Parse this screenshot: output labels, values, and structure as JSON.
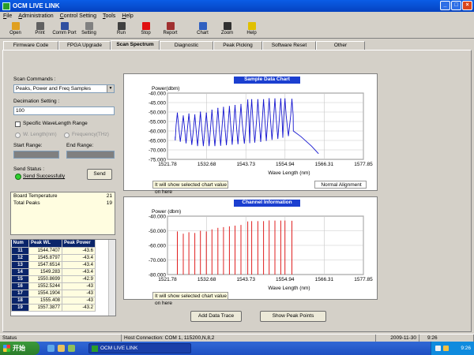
{
  "window": {
    "title": "OCM LIVE LINK"
  },
  "menu": [
    {
      "label": "File",
      "key": "F",
      "rest": "ile"
    },
    {
      "label": "Administration",
      "key": "A",
      "rest": "dministration"
    },
    {
      "label": "Control Setting",
      "key": "C",
      "rest": "ontrol Setting"
    },
    {
      "label": "Tools",
      "key": "T",
      "rest": "ools"
    },
    {
      "label": "Help",
      "key": "H",
      "rest": "elp"
    }
  ],
  "toolbar": [
    {
      "name": "open",
      "label": "Open",
      "icon": "folder-icon",
      "color": "#e0a020"
    },
    {
      "name": "print",
      "label": "Print",
      "icon": "printer-icon",
      "color": "#606060"
    },
    {
      "name": "comm-port",
      "label": "Comm Port",
      "icon": "plug-icon",
      "color": "#3050a0"
    },
    {
      "name": "setting",
      "label": "Setting",
      "icon": "gear-icon",
      "color": "#808080"
    },
    {
      "name": "run",
      "label": "Run",
      "icon": "run-icon",
      "color": "#404040"
    },
    {
      "name": "stop",
      "label": "Stop",
      "icon": "stop-icon",
      "color": "#e01010"
    },
    {
      "name": "report",
      "label": "Report",
      "icon": "report-icon",
      "color": "#a03030"
    },
    {
      "name": "chart",
      "label": "Chart",
      "icon": "chart-icon",
      "color": "#3060c0"
    },
    {
      "name": "zoom",
      "label": "Zoom",
      "icon": "magnifier-icon",
      "color": "#303030"
    },
    {
      "name": "help",
      "label": "Help",
      "icon": "bulb-icon",
      "color": "#e0c000"
    }
  ],
  "tabs": [
    {
      "label": "Firmware Code",
      "active": false
    },
    {
      "label": "FPGA Upgrade",
      "active": false
    },
    {
      "label": "Scan Spectrum",
      "active": true
    },
    {
      "label": "Diagnostic",
      "active": false
    },
    {
      "label": "Peak Picking",
      "active": false
    },
    {
      "label": "Software Reset",
      "active": false
    },
    {
      "label": "Other",
      "active": false
    }
  ],
  "scan": {
    "commands_label": "Scan Commands :",
    "command_value": "Peaks, Power and Freq Samples",
    "decimation_label": "Decimation Setting :",
    "decimation_value": "100",
    "specific_range_label": "Specific WaveLength Range",
    "radio_wl": "W. Length(nm)",
    "radio_freq": "Frequency(THz)",
    "start_label": "Start Range:",
    "end_label": "End Range:",
    "send_status_label": "Send Status :",
    "send_status_value": "Send Successfully",
    "send_button": "Send"
  },
  "info": [
    {
      "label": "Board Temperature",
      "value": "21"
    },
    {
      "label": "Total Peaks",
      "value": "19"
    }
  ],
  "peaks": {
    "headers": [
      "Num",
      "Peak WL",
      "Peak Power"
    ],
    "rows": [
      [
        "11",
        "1544.7407",
        "-43.6"
      ],
      [
        "12",
        "1545.8797",
        "-43.4"
      ],
      [
        "13",
        "1547.6514",
        "-43.4"
      ],
      [
        "14",
        "1549.283",
        "-43.4"
      ],
      [
        "15",
        "1550.8699",
        "-42.9"
      ],
      [
        "16",
        "1552.5244",
        "-43"
      ],
      [
        "17",
        "1554.1904",
        "-43"
      ],
      [
        "18",
        "1555.408",
        "-43"
      ],
      [
        "19",
        "1557.3877",
        "-43.2"
      ]
    ]
  },
  "chart1": {
    "title": "Sample Data Chart",
    "hint": "It will show selected chart value on here",
    "mode_box": "Normal Alignment"
  },
  "chart2": {
    "title": "Channel Information",
    "hint": "It will show selected chart value on here"
  },
  "buttons": {
    "add_trace": "Add Data Trace",
    "show_peaks": "Show Peak Points"
  },
  "status": {
    "left": "Status",
    "connection": "Host Connection: COM 1, 115200,N,8,2",
    "date": "2009-11-30",
    "time": "9:26"
  },
  "taskbar": {
    "start": "开始",
    "task": "OCM LIVE LINK",
    "clock": "9:26"
  },
  "chart_data": [
    {
      "type": "line",
      "title": "Sample Data Chart",
      "xlabel": "Wave Length (nm)",
      "ylabel": "Power(dbm)",
      "x_ticks": [
        "1521.78",
        "1532.68",
        "1543.73",
        "1554.94",
        "1566.31",
        "1577.85"
      ],
      "y_ticks": [
        "-40.000",
        "-45.000",
        "-50.000",
        "-55.000",
        "-60.000",
        "-65.000",
        "-70.000",
        "-75.000"
      ],
      "xlim": [
        1521.78,
        1577.85
      ],
      "ylim": [
        -75,
        -40
      ],
      "grid": true,
      "color": "#1515d0",
      "peaks": [
        {
          "x": 1524.6,
          "y": -50.5
        },
        {
          "x": 1526.3,
          "y": -52
        },
        {
          "x": 1527.9,
          "y": -51
        },
        {
          "x": 1529.6,
          "y": -51.5
        },
        {
          "x": 1531.2,
          "y": -50
        },
        {
          "x": 1532.9,
          "y": -50.5
        },
        {
          "x": 1534.5,
          "y": -49
        },
        {
          "x": 1536.2,
          "y": -48
        },
        {
          "x": 1537.8,
          "y": -47.5
        },
        {
          "x": 1539.5,
          "y": -47
        },
        {
          "x": 1541.1,
          "y": -46.5
        },
        {
          "x": 1542.8,
          "y": -46
        },
        {
          "x": 1544.74,
          "y": -43.6
        },
        {
          "x": 1545.88,
          "y": -43.4
        },
        {
          "x": 1547.65,
          "y": -43.4
        },
        {
          "x": 1549.28,
          "y": -43.4
        },
        {
          "x": 1550.87,
          "y": -42.9
        },
        {
          "x": 1552.52,
          "y": -43
        },
        {
          "x": 1554.19,
          "y": -43
        },
        {
          "x": 1555.41,
          "y": -43
        },
        {
          "x": 1557.39,
          "y": -43.2
        }
      ],
      "baseline": [
        {
          "x": 1524.0,
          "y": -63
        },
        {
          "x": 1530.0,
          "y": -66
        },
        {
          "x": 1536.0,
          "y": -66
        },
        {
          "x": 1542.0,
          "y": -65
        },
        {
          "x": 1548.0,
          "y": -64
        },
        {
          "x": 1554.0,
          "y": -62
        },
        {
          "x": 1557.8,
          "y": -60
        },
        {
          "x": 1560.0,
          "y": -63
        },
        {
          "x": 1563.0,
          "y": -68
        },
        {
          "x": 1565.0,
          "y": -72
        }
      ]
    },
    {
      "type": "bar",
      "title": "Channel Information",
      "xlabel": "Wave Length (nm)",
      "ylabel": "Power (dbm)",
      "x_ticks": [
        "1521.78",
        "1532.68",
        "1543.73",
        "1554.94",
        "1566.31",
        "1577.85"
      ],
      "y_ticks": [
        "-40.000",
        "-50.000",
        "-60.000",
        "-70.000",
        "-80.000"
      ],
      "xlim": [
        1521.78,
        1577.85
      ],
      "ylim": [
        -80,
        -40
      ],
      "grid": true,
      "color": "#e02020",
      "points": [
        {
          "x": 1524.6,
          "y": -50.5
        },
        {
          "x": 1526.3,
          "y": -52
        },
        {
          "x": 1527.9,
          "y": -51
        },
        {
          "x": 1529.6,
          "y": -51.5
        },
        {
          "x": 1531.2,
          "y": -50
        },
        {
          "x": 1532.9,
          "y": -50.5
        },
        {
          "x": 1534.5,
          "y": -49
        },
        {
          "x": 1536.2,
          "y": -48
        },
        {
          "x": 1537.8,
          "y": -47.5
        },
        {
          "x": 1539.5,
          "y": -47
        },
        {
          "x": 1541.1,
          "y": -46.5
        },
        {
          "x": 1542.8,
          "y": -46
        },
        {
          "x": 1544.74,
          "y": -43.6
        },
        {
          "x": 1545.88,
          "y": -43.4
        },
        {
          "x": 1547.65,
          "y": -43.4
        },
        {
          "x": 1549.28,
          "y": -43.4
        },
        {
          "x": 1550.87,
          "y": -42.9
        },
        {
          "x": 1552.52,
          "y": -43
        },
        {
          "x": 1554.19,
          "y": -43
        },
        {
          "x": 1555.41,
          "y": -43
        },
        {
          "x": 1557.39,
          "y": -43.2
        }
      ]
    }
  ]
}
